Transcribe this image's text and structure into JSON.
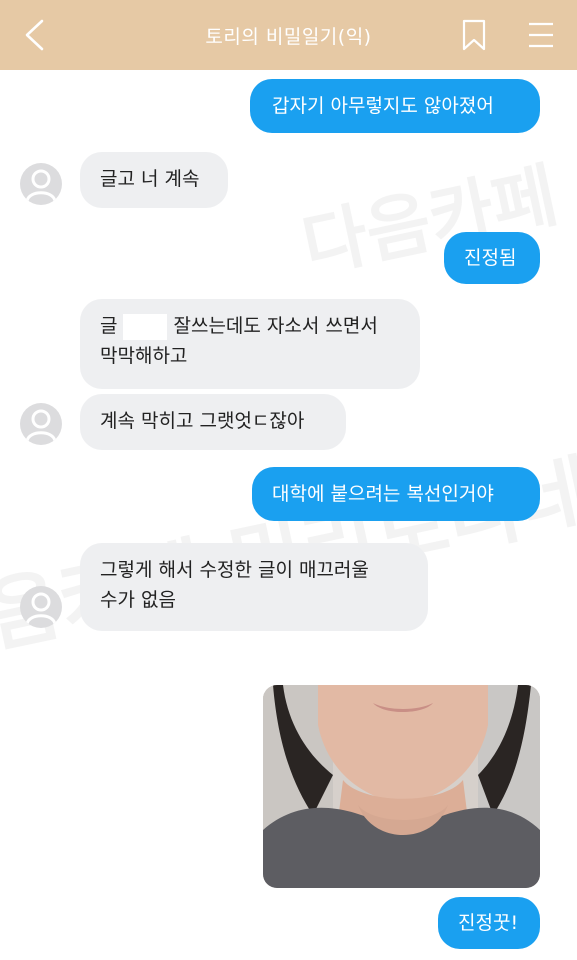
{
  "header": {
    "title": "토리의 비밀일기(익)",
    "back_icon": "chevron-left-icon",
    "bookmark_icon": "bookmark-icon",
    "menu_icon": "hamburger-menu-icon",
    "background_color": "#e6c9a5"
  },
  "watermark": {
    "text_1": "다음카페",
    "text_2": "음카페 밀리토리네",
    "text_3": "믈"
  },
  "messages": {
    "m1": "갑자기 아무렇지도 않아졌어",
    "m2": "글고 너 계속",
    "m3": "진정됨",
    "m4_a": "글",
    "m4_b": "잘쓰는데도 자소서 쓰면서",
    "m4_c": "막막해하고",
    "m5": "계속 막히고 그랫엇ㄷ잖아",
    "m6": "대학에 붙으려는 복선인거야",
    "m7_a": "그렇게 해서 수정한 글이 매끄러울",
    "m7_b": "수가 없음",
    "m8": "진정꿋!"
  },
  "colors": {
    "outgoing_bubble": "#1aa0f0",
    "incoming_bubble": "#eeeff1"
  }
}
